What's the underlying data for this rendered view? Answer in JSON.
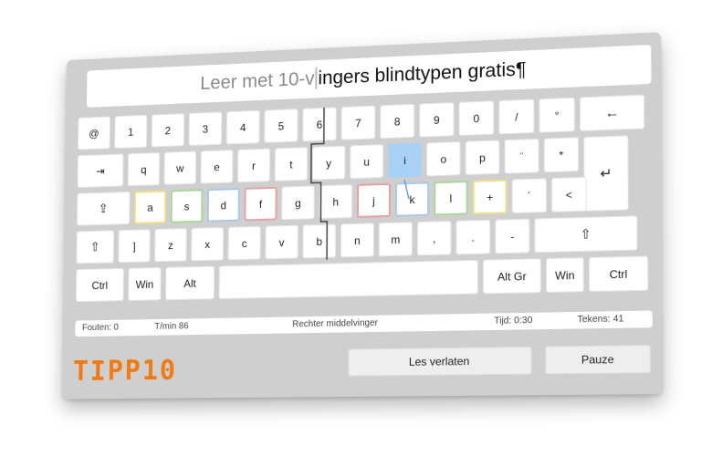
{
  "text": {
    "typed": "Leer met 10-v",
    "remaining": "ingers blindtypen gratis¶"
  },
  "keyboard": {
    "row1": [
      "@",
      "1",
      "2",
      "3",
      "4",
      "5",
      "6",
      "7",
      "8",
      "9",
      "0",
      "/",
      "°",
      "←"
    ],
    "row2": [
      "⇥",
      "q",
      "w",
      "e",
      "r",
      "t",
      "y",
      "u",
      "i",
      "o",
      "p",
      "¨",
      "*",
      "↵"
    ],
    "row3": [
      "⇪",
      "a",
      "s",
      "d",
      "f",
      "g",
      "h",
      "j",
      "k",
      "l",
      "+",
      "´",
      "<"
    ],
    "row4": [
      "⇧",
      "]",
      "z",
      "x",
      "c",
      "v",
      "b",
      "n",
      "m",
      ",",
      ".",
      "-",
      "⇧"
    ],
    "row5": [
      "Ctrl",
      "Win",
      "Alt",
      "",
      "Alt Gr",
      "Win",
      "Ctrl"
    ],
    "highlighted_key": "i"
  },
  "status": {
    "errors": "Fouten: 0",
    "speed": "T/min 86",
    "finger": "Rechter middelvinger",
    "time": "Tijd: 0:30",
    "chars": "Tekens: 41"
  },
  "logo": "TIPP10",
  "buttons": {
    "leave": "Les verlaten",
    "pause": "Pauze"
  },
  "colors": {
    "panel": "#cfcfcf",
    "highlight": "#a9d1f5",
    "logo": "#f07a14"
  }
}
